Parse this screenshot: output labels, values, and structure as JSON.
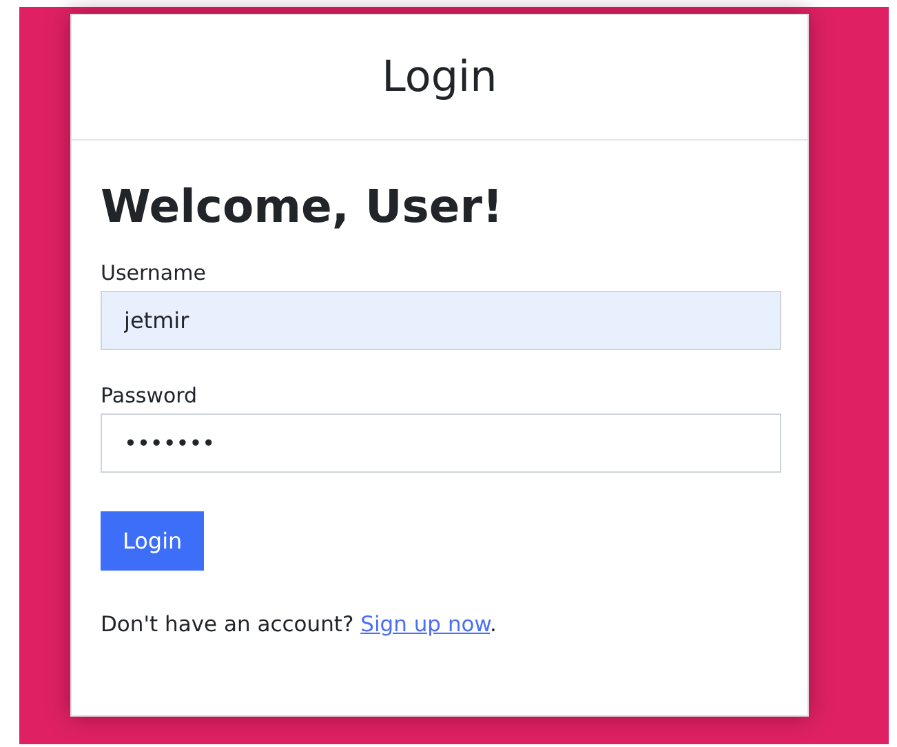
{
  "card": {
    "title": "Login"
  },
  "form": {
    "heading": "Welcome, User!",
    "fields": [
      {
        "label": "Username",
        "value": "jetmir",
        "autofilled": true
      },
      {
        "label": "Password",
        "value": "•••••••",
        "autofilled": false
      }
    ],
    "button": "Login",
    "signup": {
      "text": "Don't have an account?",
      "link": "Sign up now",
      "suffix": "."
    }
  }
}
